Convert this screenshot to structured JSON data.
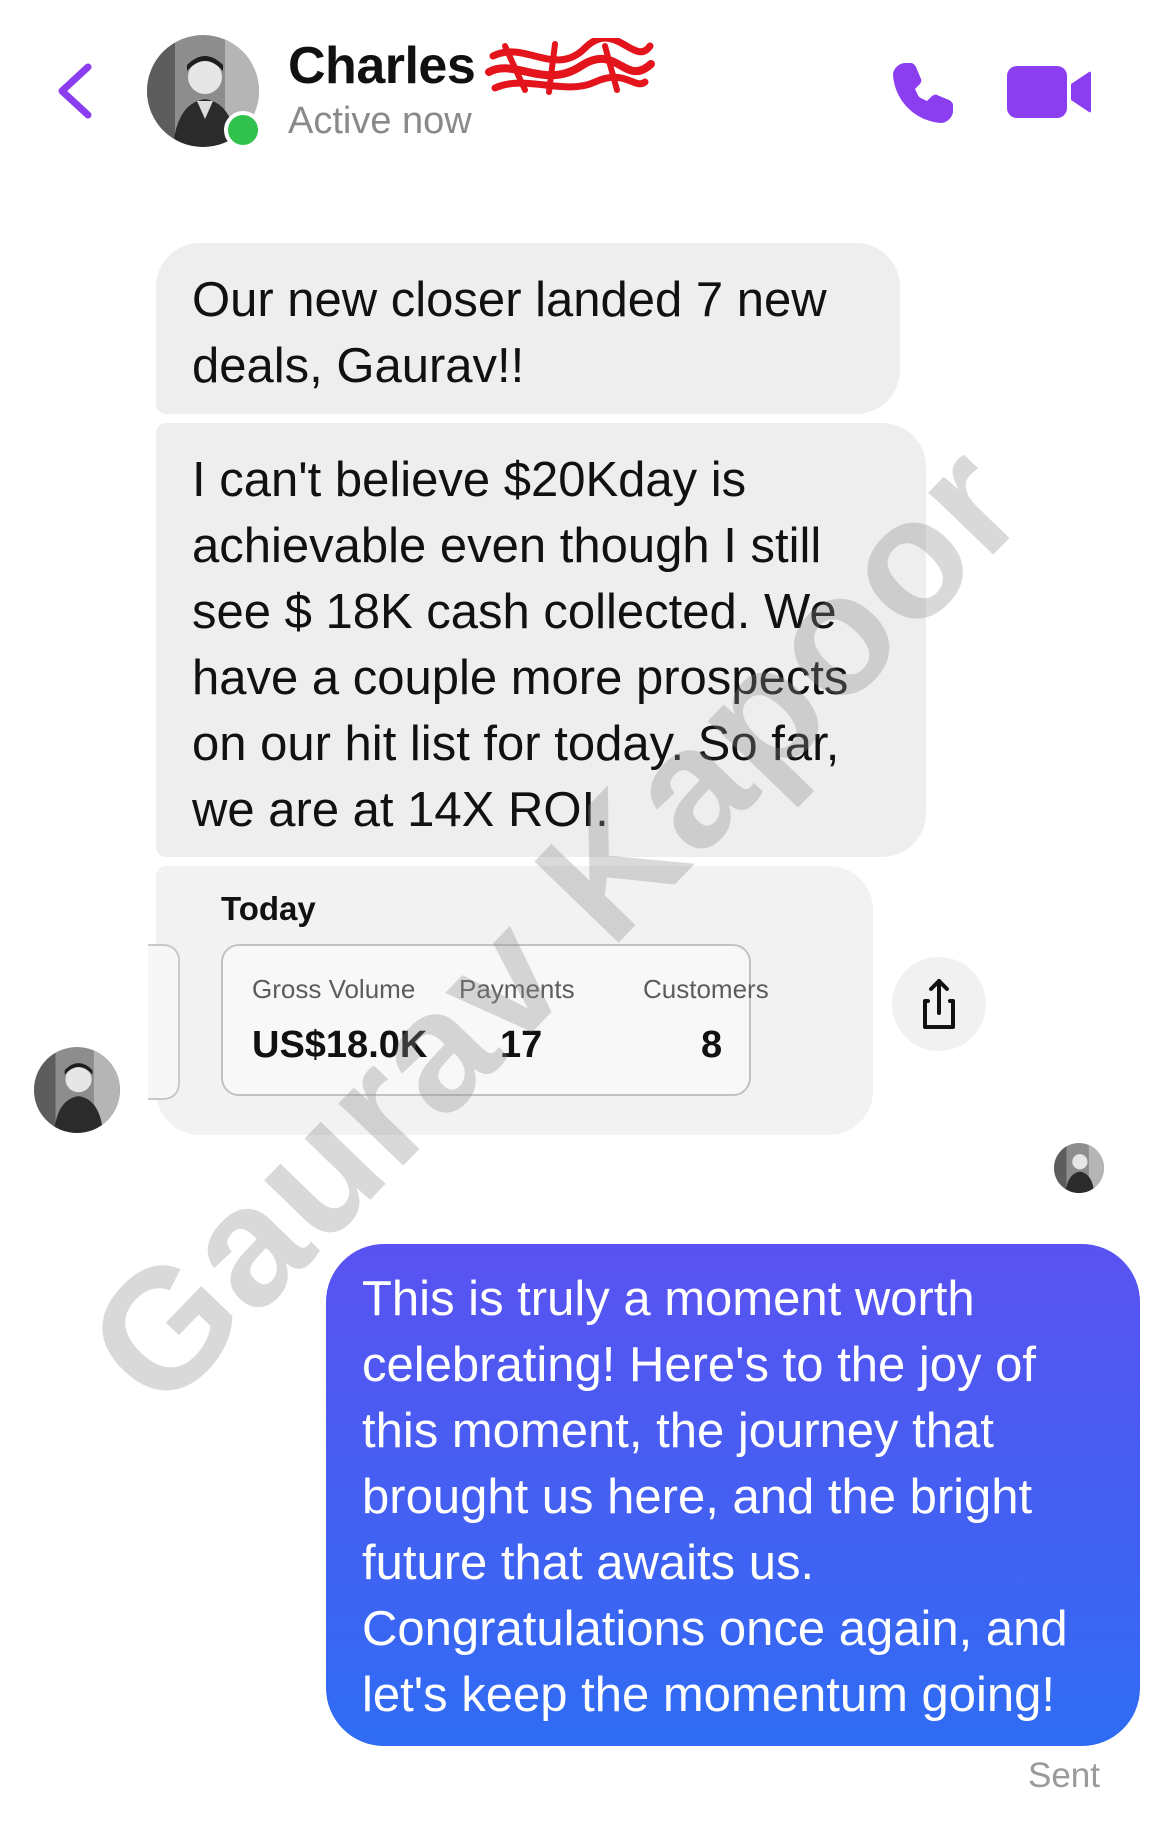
{
  "header": {
    "contact_name": "Charles",
    "status": "Active now",
    "accent_color": "#8b3df0"
  },
  "messages": {
    "incoming": [
      {
        "text": "Our new closer landed 7 new\ndeals, Gaurav!!"
      },
      {
        "text": "I can't believe $20Kday is\nachievable even though I still\nsee $ 18K cash collected. We\nhave a couple more prospects\non our hit list for today. So far,\nwe are at 14X ROI."
      }
    ],
    "card": {
      "title": "Today",
      "stats": [
        {
          "label": "Gross Volume",
          "value": "US$18.0K"
        },
        {
          "label": "Payments",
          "value": "17"
        },
        {
          "label": "Customers",
          "value": "8"
        }
      ]
    },
    "outgoing": {
      "text": "This is truly a moment worth\ncelebrating! Here's to the joy of\nthis moment, the journey that\nbrought us here, and the bright\nfuture that awaits us.\nCongratulations once again, and\nlet's keep the momentum going!",
      "status": "Sent",
      "bubble_color": "#4a5df3"
    }
  },
  "watermark": {
    "text": "Gaurav Kapoor"
  },
  "icons": {
    "back": "chevron-left-icon",
    "call": "phone-icon",
    "video": "video-camera-icon",
    "share": "share-icon"
  }
}
